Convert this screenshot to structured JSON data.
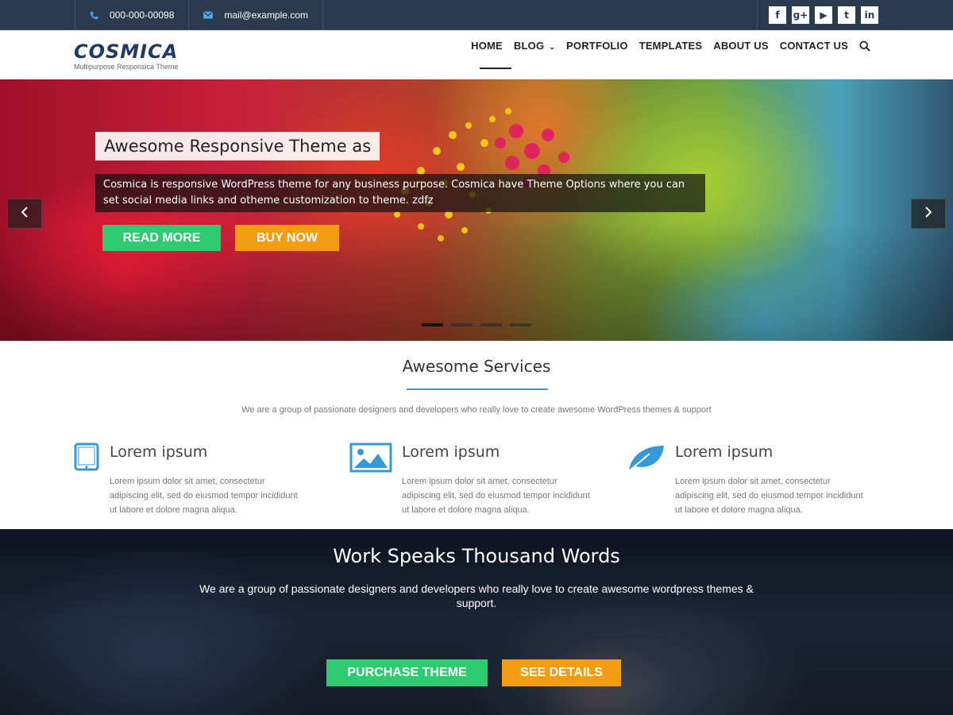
{
  "topbar": {
    "phone": "000-000-00098",
    "email": "mail@example.com",
    "phone_icon": "phone-icon",
    "email_icon": "envelope-icon",
    "social": [
      {
        "name": "facebook-icon",
        "glyph": "f"
      },
      {
        "name": "google-plus-icon",
        "glyph": "g+"
      },
      {
        "name": "youtube-icon",
        "glyph": "▶"
      },
      {
        "name": "twitter-icon",
        "glyph": "t"
      },
      {
        "name": "linkedin-icon",
        "glyph": "in"
      }
    ]
  },
  "header": {
    "logo": "COSMICA",
    "tagline": "Multipurpose Responsica Theme",
    "nav": [
      "HOME",
      "BLOG",
      "PORTFOLIO",
      "TEMPLATES",
      "ABOUT US",
      "CONTACT US"
    ],
    "active_nav": "HOME"
  },
  "hero": {
    "headline": "Awesome Responsive Theme as",
    "description": "Cosmica is responsive WordPress theme for any business purpose. Cosmica have Theme Options where you can set social media links and otheme customization to theme. zdfz",
    "read_more": "READ MORE",
    "buy_now": "BUY NOW",
    "prev_arrow": "‹",
    "next_arrow": "›",
    "slide_count": 4,
    "active_slide": 1
  },
  "services": {
    "title": "Awesome Services",
    "subtitle": "We are a group of passionate designers and developers who really love to create awesome WordPress themes & support",
    "items": [
      {
        "icon": "tablet-icon",
        "title": "Lorem ipsum",
        "text": "Lorem ipsum dolor sit amet, consectetur adipiscing elit, sed do eiusmod tempor incididunt ut labore et dolore magna aliqua."
      },
      {
        "icon": "image-icon",
        "title": "Lorem ipsum",
        "text": "Lorem ipsum dolor sit amet, consectetur adipiscing elit, sed do eiusmod tempor incididunt ut labore et dolore magna aliqua."
      },
      {
        "icon": "leaf-icon",
        "title": "Lorem ipsum",
        "text": "Lorem ipsum dolor sit amet, consectetur adipiscing elit, sed do eiusmod tempor incididunt ut labore et dolore magna aliqua."
      }
    ]
  },
  "work": {
    "title": "Work Speaks Thousand Words",
    "subtitle": "We are a group of passionate designers and developers who really love to create awesome wordpress themes & support.",
    "purchase": "PURCHASE THEME",
    "details": "SEE DETAILS"
  },
  "colors": {
    "topbar": "#2b3a4e",
    "accent_blue": "#3498db",
    "green": "#2ecc71",
    "orange": "#f39c12",
    "logo": "#1f3a63"
  }
}
